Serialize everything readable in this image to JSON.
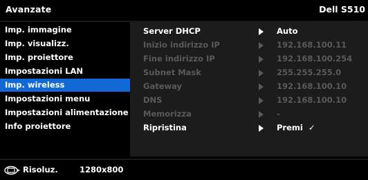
{
  "header": {
    "title": "Avanzate",
    "model": "Dell S510"
  },
  "menu": {
    "items": [
      {
        "label": "Imp. immagine"
      },
      {
        "label": "Imp. visualizz."
      },
      {
        "label": "Imp. proiettore"
      },
      {
        "label": "Impostazioni LAN"
      },
      {
        "label": "Imp. wireless",
        "selected": true
      },
      {
        "label": "Impostazioni menu"
      },
      {
        "label": "Impostazioni alimentazione"
      },
      {
        "label": "Info proiettore"
      }
    ]
  },
  "settings": {
    "rows": [
      {
        "label": "Server DHCP",
        "value": "Auto",
        "enabled": true
      },
      {
        "label": "Inizio indirizzo IP",
        "value": "192.168.100.11",
        "enabled": false
      },
      {
        "label": "Fine indirizzo IP",
        "value": "192.168.100.254",
        "enabled": false
      },
      {
        "label": "Subnet Mask",
        "value": "255.255.255.0",
        "enabled": false
      },
      {
        "label": "Gateway",
        "value": "192.168.100.10",
        "enabled": false
      },
      {
        "label": "DNS",
        "value": "192.168.100.10",
        "enabled": false
      },
      {
        "label": "Memorizza",
        "value": "-",
        "enabled": false
      },
      {
        "label": "Ripristina",
        "value": "Premi",
        "check": "✓",
        "enabled": true
      }
    ]
  },
  "footer": {
    "label": "Risoluz.",
    "resolution": "1280x800",
    "icon": "display-icon"
  },
  "colors": {
    "selected": "#1269d6",
    "panel": "#1c1c1c",
    "disabled": "#5a5a5a"
  }
}
